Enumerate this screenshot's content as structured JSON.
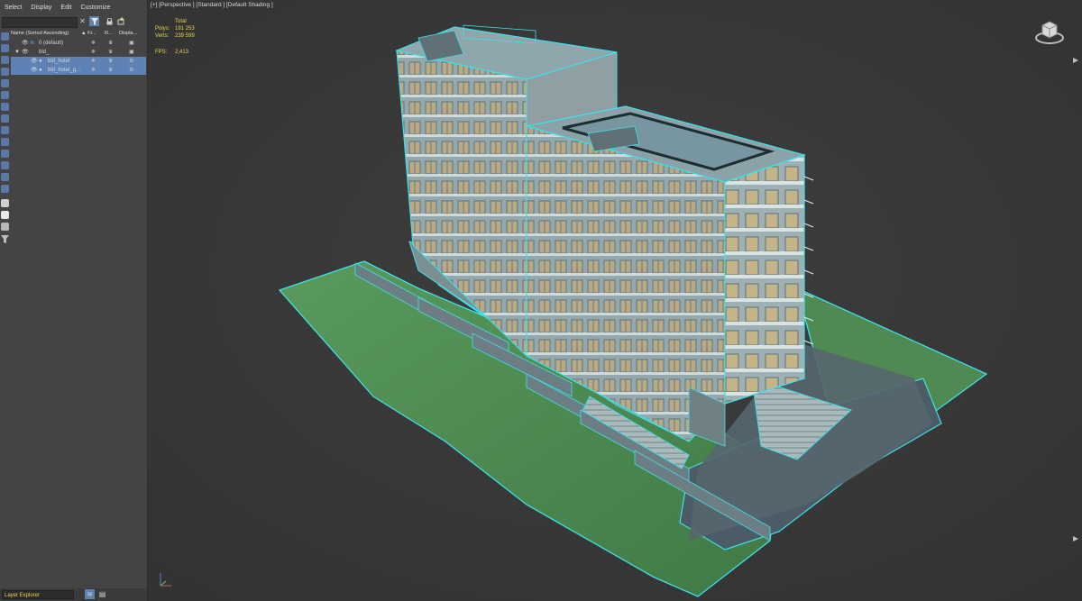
{
  "menu": [
    "Select",
    "Display",
    "Edit",
    "Customize"
  ],
  "columns": {
    "name": "Name (Sorted Ascending)",
    "frozen": "▲ Fr...",
    "render": "R...",
    "display": "Displa..."
  },
  "tree": [
    {
      "label": "0 (default)",
      "selected": false
    },
    {
      "label": "bld_",
      "selected": false
    },
    {
      "label": "bld_hotel",
      "selected": true
    },
    {
      "label": "bld_hotel_g...",
      "selected": true
    }
  ],
  "bottom": {
    "layer_explorer": "Layer Explorer"
  },
  "viewport": {
    "label": "[+] [Perspective ] [Standard ] [Default Shading ]",
    "stats": {
      "header": "Total",
      "polys_label": "Polys:",
      "polys_value": "191 253",
      "verts_label": "Verts:",
      "verts_value": "239 599",
      "fps_label": "FPS:",
      "fps_value": "2,413"
    }
  },
  "colors": {
    "panel_bg": "#444444",
    "viewport_bg": "#3a3a3a",
    "selection": "#5e82b4",
    "stats_text": "#e7d44a",
    "outline": "#3fe0e8",
    "grass": "#4f8a52",
    "building": "#8fa2a6"
  },
  "icons": {
    "toolbar": [
      "close-icon",
      "filter-icon",
      "lock-icon",
      "add-layer-icon"
    ],
    "bottom": [
      "layers-icon",
      "table-icon"
    ]
  }
}
